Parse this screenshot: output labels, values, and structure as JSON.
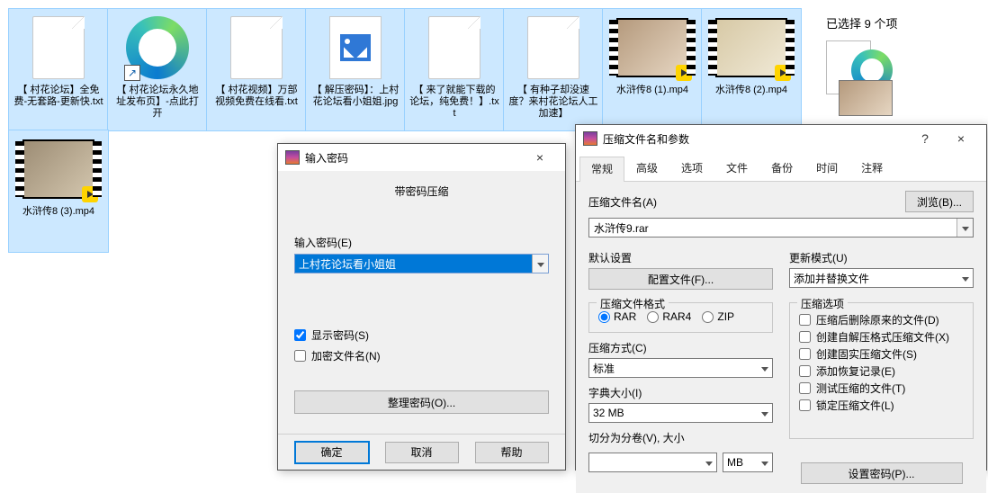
{
  "details": {
    "header": "已选择 9 个项"
  },
  "files": [
    {
      "label": "【 村花论坛】全免费-无套路-更新快.txt",
      "kind": "doc"
    },
    {
      "label": "【 村花论坛永久地址发布页】-点此打开",
      "kind": "edge"
    },
    {
      "label": "【 村花视频】万部视频免费在线看.txt",
      "kind": "doc"
    },
    {
      "label": "【 解压密码】：上村花论坛看小姐姐.jpg",
      "kind": "img"
    },
    {
      "label": "【 来了就能下载的论坛，纯免费！】.txt",
      "kind": "doc"
    },
    {
      "label": "【 有种子却没速度？来村花论坛人工加速】",
      "kind": "doc"
    },
    {
      "label": "水浒传8 (1).mp4",
      "kind": "vid1"
    },
    {
      "label": "水浒传8 (2).mp4",
      "kind": "vid2"
    },
    {
      "label": "水浒传8 (3).mp4",
      "kind": "vid3",
      "row2": true
    }
  ],
  "pwDialog": {
    "title": "输入密码",
    "subtitle": "带密码压缩",
    "fieldLabel": "输入密码(E)",
    "password": "上村花论坛看小姐姐",
    "showPw": "显示密码(S)",
    "encName": "加密文件名(N)",
    "organize": "整理密码(O)...",
    "ok": "确定",
    "cancel": "取消",
    "help": "帮助",
    "close": "×"
  },
  "arDialog": {
    "title": "压缩文件名和参数",
    "help": "?",
    "close": "×",
    "tabs": [
      "常规",
      "高级",
      "选项",
      "文件",
      "备份",
      "时间",
      "注释"
    ],
    "archiveNameLabel": "压缩文件名(A)",
    "archiveName": "水浒传9.rar",
    "browse": "浏览(B)...",
    "defaultCfgLabel": "默认设置",
    "defaultCfgBtn": "配置文件(F)...",
    "updateLabel": "更新模式(U)",
    "updateValue": "添加并替换文件",
    "formatLabel": "压缩文件格式",
    "formats": {
      "rar": "RAR",
      "rar4": "RAR4",
      "zip": "ZIP"
    },
    "optionsLabel": "压缩选项",
    "options": [
      "压缩后删除原来的文件(D)",
      "创建自解压格式压缩文件(X)",
      "创建固实压缩文件(S)",
      "添加恢复记录(E)",
      "测试压缩的文件(T)",
      "锁定压缩文件(L)"
    ],
    "methodLabel": "压缩方式(C)",
    "methodValue": "标准",
    "dictLabel": "字典大小(I)",
    "dictValue": "32 MB",
    "splitLabel": "切分为分卷(V), 大小",
    "splitUnit": "MB",
    "setPw": "设置密码(P)..."
  }
}
